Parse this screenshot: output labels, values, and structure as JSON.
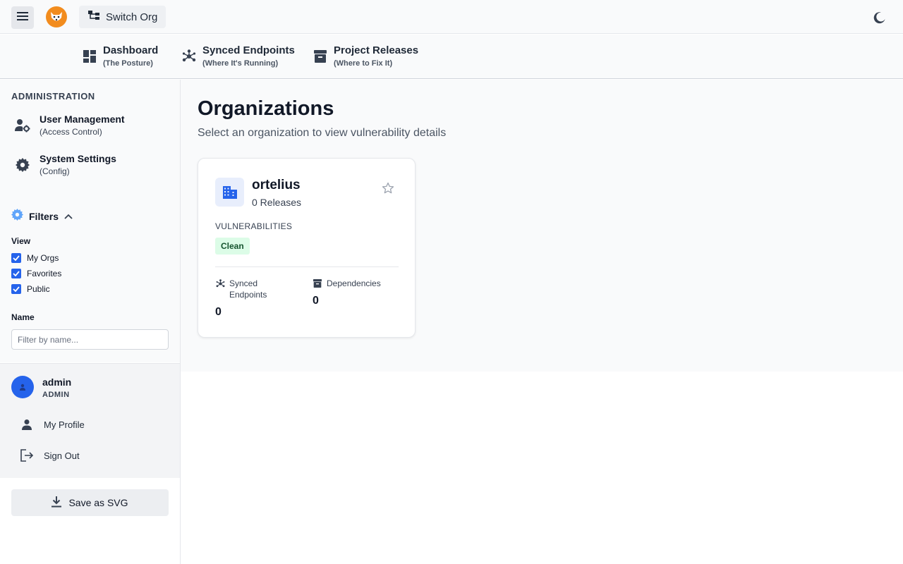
{
  "topbar": {
    "switch_org_label": "Switch Org"
  },
  "nav": {
    "items": [
      {
        "title": "Dashboard",
        "subtitle": "(The Posture)"
      },
      {
        "title": "Synced Endpoints",
        "subtitle": "(Where It's Running)"
      },
      {
        "title": "Project Releases",
        "subtitle": "(Where to Fix It)"
      }
    ]
  },
  "sidebar": {
    "section_label": "ADMINISTRATION",
    "admin_items": [
      {
        "title": "User Management",
        "subtitle": "(Access Control)"
      },
      {
        "title": "System Settings",
        "subtitle": "(Config)"
      }
    ],
    "filters": {
      "title": "Filters",
      "view_label": "View",
      "checkboxes": [
        {
          "label": "My Orgs",
          "checked": true
        },
        {
          "label": "Favorites",
          "checked": true
        },
        {
          "label": "Public",
          "checked": true
        }
      ],
      "name_label": "Name",
      "name_placeholder": "Filter by name...",
      "name_value": ""
    },
    "user": {
      "name": "admin",
      "role": "ADMIN",
      "links": [
        {
          "label": "My Profile",
          "icon": "person-icon"
        },
        {
          "label": "Sign Out",
          "icon": "logout-icon"
        }
      ]
    },
    "save_label": "Save as SVG"
  },
  "main": {
    "title": "Organizations",
    "subtitle": "Select an organization to view vulnerability details",
    "cards": [
      {
        "name": "ortelius",
        "releases": "0 Releases",
        "vuln_label": "VULNERABILITIES",
        "status": "Clean",
        "stats": [
          {
            "label": "Synced Endpoints",
            "value": "0"
          },
          {
            "label": "Dependencies",
            "value": "0"
          }
        ]
      }
    ]
  },
  "colors": {
    "accent": "#2563eb",
    "logo": "#f28c1e",
    "clean_bg": "#dcfce7",
    "clean_text": "#14532d"
  }
}
